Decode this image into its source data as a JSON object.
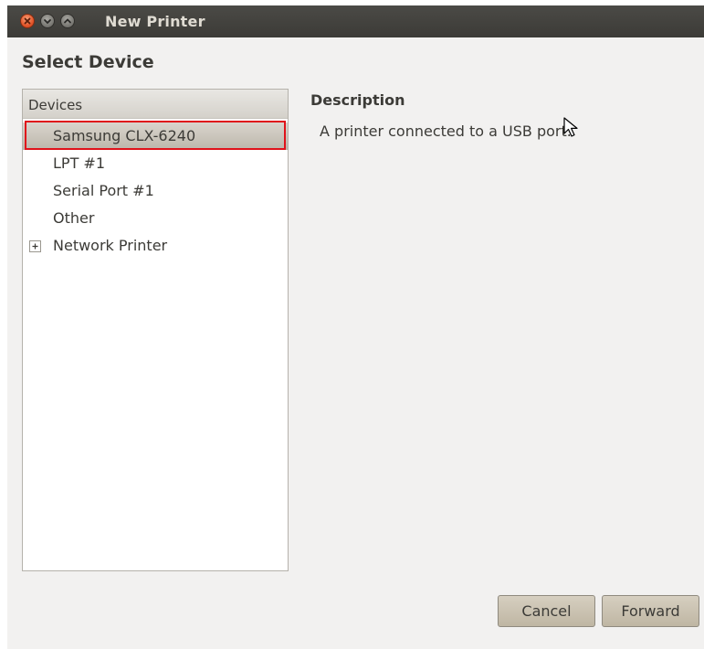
{
  "window": {
    "title": "New Printer",
    "controls": [
      "close-icon",
      "minimize-icon",
      "maximize-icon"
    ]
  },
  "page": {
    "heading": "Select Device"
  },
  "devices": {
    "header": "Devices",
    "items": [
      {
        "label": "Samsung CLX-6240",
        "selected": true
      },
      {
        "label": "LPT #1"
      },
      {
        "label": "Serial Port #1"
      },
      {
        "label": "Other"
      },
      {
        "label": "Network Printer",
        "expandable": true
      }
    ]
  },
  "description": {
    "title": "Description",
    "text": "A printer connected to a USB port."
  },
  "buttons": {
    "cancel": "Cancel",
    "forward": "Forward"
  },
  "colors": {
    "titlebar": "#3c3b37",
    "close_button": "#e4552a",
    "selection_outline": "#e0131b",
    "selected_row": "#c9c4ba"
  }
}
